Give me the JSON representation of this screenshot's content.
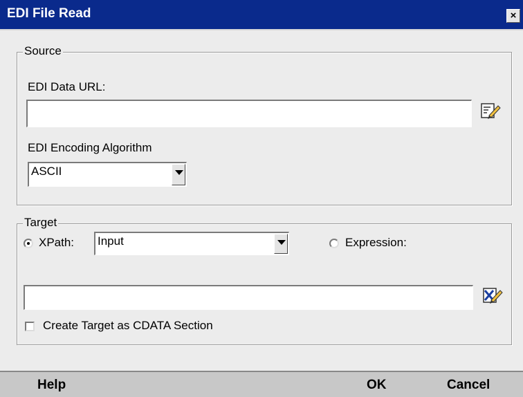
{
  "window": {
    "title": "EDI File Read",
    "close_label": "×"
  },
  "source": {
    "legend": "Source",
    "data_url_label": "EDI Data URL:",
    "data_url_value": "",
    "encoding_label": "EDI Encoding Algorithm",
    "encoding_value": "ASCII"
  },
  "target": {
    "legend": "Target",
    "xpath_label": "XPath:",
    "xpath_value": "Input",
    "xpath_selected": true,
    "expression_label": "Expression:",
    "expression_selected": false,
    "target_value": "",
    "cdata_label": "Create Target as CDATA Section",
    "cdata_checked": false
  },
  "footer": {
    "help_label": "Help",
    "ok_label": "OK",
    "cancel_label": "Cancel"
  },
  "icons": [
    "edit-icon",
    "close-icon",
    "dropdown-arrow-icon"
  ]
}
